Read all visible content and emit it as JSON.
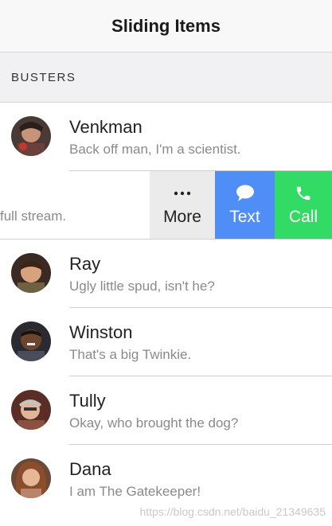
{
  "toolbar": {
    "title": "Sliding Items"
  },
  "list": {
    "header": "BUSTERS",
    "items": [
      {
        "name": "Venkman",
        "message": "Back off man, I'm a scientist."
      },
      {
        "name": "Ray",
        "message": "Ugly little spud, isn't he?"
      },
      {
        "name": "Winston",
        "message": "That's a big Twinkie."
      },
      {
        "name": "Tully",
        "message": "Okay, who brought the dog?"
      },
      {
        "name": "Dana",
        "message": "I am The Gatekeeper!"
      }
    ],
    "slid_item": {
      "visible_message": "full stream.",
      "options": {
        "more": {
          "label": "More",
          "icon": "more-icon"
        },
        "text": {
          "label": "Text",
          "icon": "chat-bubble-icon",
          "color": "#4f8ef7"
        },
        "call": {
          "label": "Call",
          "icon": "phone-icon",
          "color": "#32db64"
        }
      }
    }
  },
  "watermark": "https://blog.csdn.net/baidu_21349635"
}
